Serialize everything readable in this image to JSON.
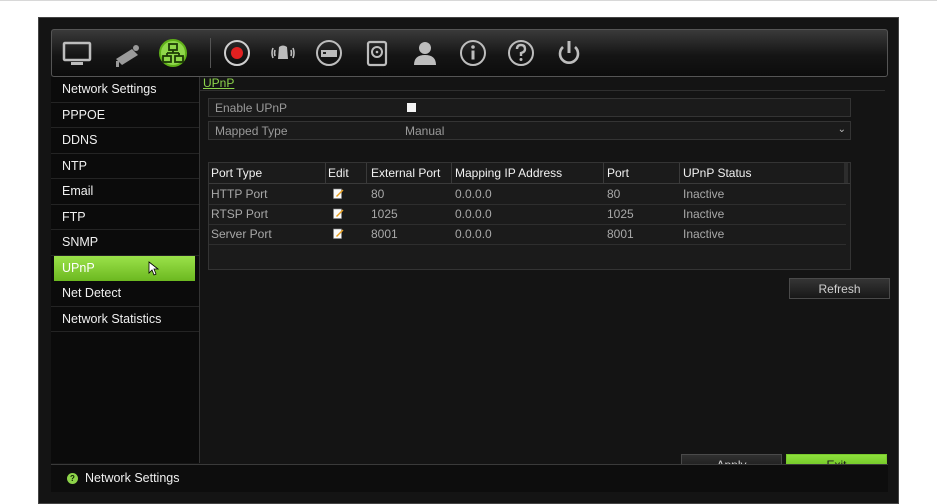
{
  "toolbar": {
    "icons": [
      "monitor-icon",
      "camera-icon",
      "network-icon",
      "record-icon",
      "alarm-icon",
      "device-icon",
      "hdd-icon",
      "user-icon",
      "info-icon",
      "help-icon",
      "power-icon"
    ]
  },
  "sidebar": {
    "items": [
      {
        "label": "Network Settings"
      },
      {
        "label": "PPPOE"
      },
      {
        "label": "DDNS"
      },
      {
        "label": "NTP"
      },
      {
        "label": "Email"
      },
      {
        "label": "FTP"
      },
      {
        "label": "SNMP"
      },
      {
        "label": "UPnP"
      },
      {
        "label": "Net Detect"
      },
      {
        "label": "Network Statistics"
      }
    ],
    "active": "UPnP"
  },
  "main": {
    "title": "UPnP",
    "enable_label": "Enable UPnP",
    "enable_checked": true,
    "mapped_type_label": "Mapped Type",
    "mapped_type_value": "Manual",
    "table": {
      "headers": [
        "Port Type",
        "Edit",
        "External Port",
        "Mapping IP Address",
        "Port",
        "UPnP Status"
      ],
      "rows": [
        {
          "port_type": "HTTP Port",
          "external_port": "80",
          "mapping_ip": "0.0.0.0",
          "port": "80",
          "status": "Inactive"
        },
        {
          "port_type": "RTSP Port",
          "external_port": "1025",
          "mapping_ip": "0.0.0.0",
          "port": "1025",
          "status": "Inactive"
        },
        {
          "port_type": "Server Port",
          "external_port": "8001",
          "mapping_ip": "0.0.0.0",
          "port": "8001",
          "status": "Inactive"
        }
      ]
    },
    "refresh_label": "Refresh",
    "apply_label": "Apply",
    "exit_label": "Exit"
  },
  "status": {
    "text": "Network Settings",
    "icon": "help-icon"
  },
  "colors": {
    "accent": "#7fcf2e",
    "background": "#141414"
  }
}
